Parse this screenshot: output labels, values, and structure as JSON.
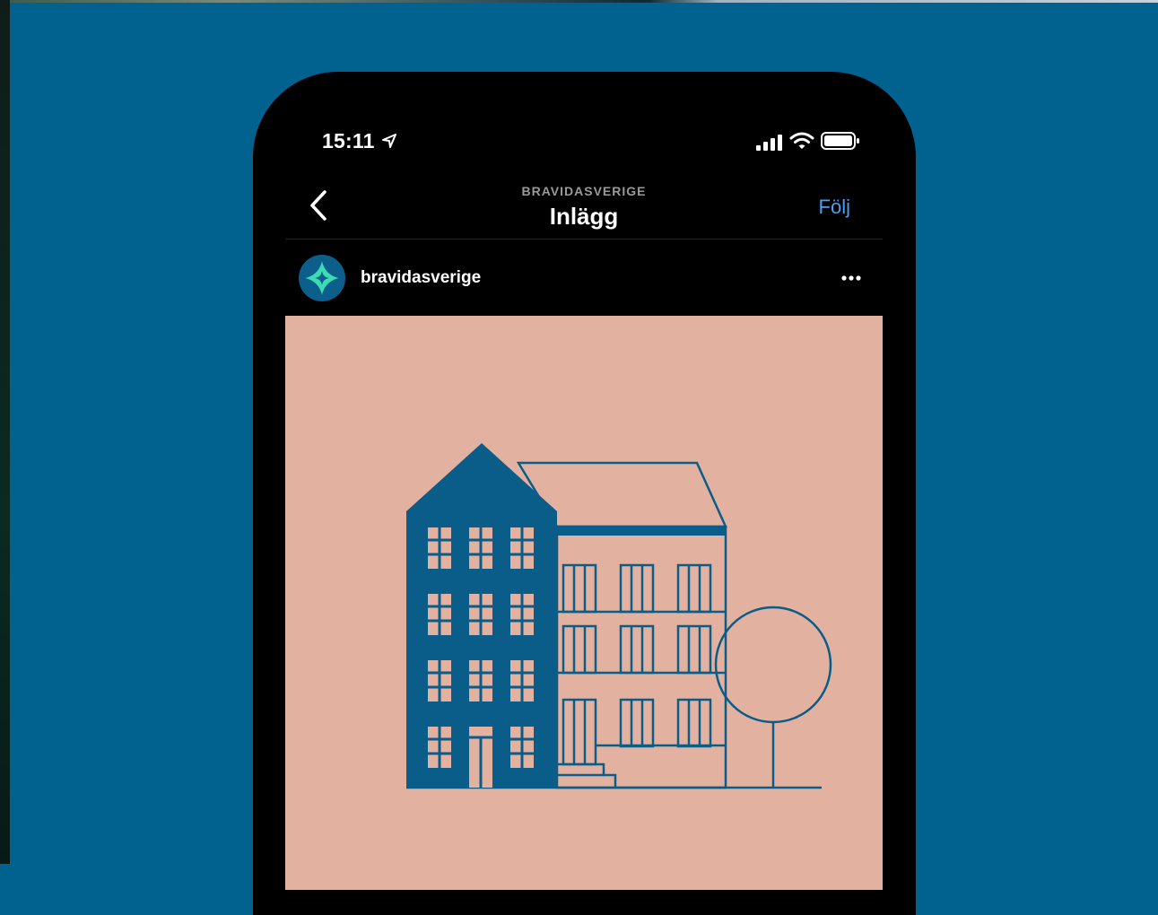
{
  "status_bar": {
    "time": "15:11",
    "icons": [
      "location-arrow-icon",
      "cellular-signal-icon",
      "wifi-icon",
      "battery-icon"
    ]
  },
  "nav": {
    "subtitle": "BRAVIDASVERIGE",
    "title": "Inlägg",
    "follow_label": "Följ",
    "back_icon": "chevron-left-icon"
  },
  "post": {
    "username": "bravidasverige",
    "more_icon": "ellipsis-icon",
    "image_subject": "building-illustration"
  },
  "colors": {
    "background": "#01628f",
    "phone_frame": "#000000",
    "accent_link": "#4b9ef0",
    "post_image_bg": "#e3b19f",
    "illustration_blue": "#0a5c89",
    "avatar_star": "#3ddbb4"
  }
}
